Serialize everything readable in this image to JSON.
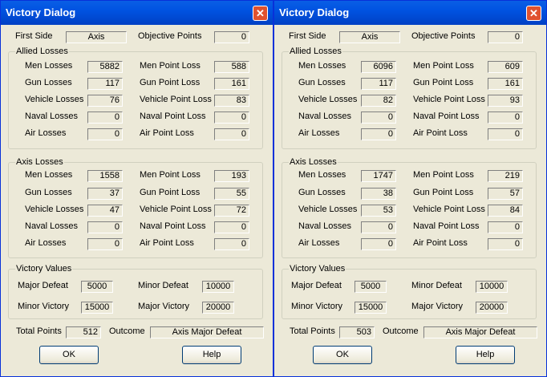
{
  "dialogs": [
    {
      "title": "Victory Dialog",
      "close_glyph": "✕",
      "first_side_label": "First Side",
      "first_side_value": "Axis",
      "objective_points_label": "Objective Points",
      "objective_points_value": "0",
      "allied": {
        "title": "Allied Losses",
        "men_losses_label": "Men Losses",
        "men_losses": "5882",
        "men_point_loss_label": "Men Point Loss",
        "men_point_loss": "588",
        "gun_losses_label": "Gun Losses",
        "gun_losses": "117",
        "gun_point_loss_label": "Gun Point Loss",
        "gun_point_loss": "161",
        "vehicle_losses_label": "Vehicle Losses",
        "vehicle_losses": "76",
        "vehicle_point_loss_label": "Vehicle Point Loss",
        "vehicle_point_loss": "83",
        "naval_losses_label": "Naval Losses",
        "naval_losses": "0",
        "naval_point_loss_label": "Naval Point Loss",
        "naval_point_loss": "0",
        "air_losses_label": "Air Losses",
        "air_losses": "0",
        "air_point_loss_label": "Air Point Loss",
        "air_point_loss": "0"
      },
      "axis": {
        "title": "Axis Losses",
        "men_losses_label": "Men Losses",
        "men_losses": "1558",
        "men_point_loss_label": "Men Point Loss",
        "men_point_loss": "193",
        "gun_losses_label": "Gun Losses",
        "gun_losses": "37",
        "gun_point_loss_label": "Gun Point Loss",
        "gun_point_loss": "55",
        "vehicle_losses_label": "Vehicle Losses",
        "vehicle_losses": "47",
        "vehicle_point_loss_label": "Vehicle Point Loss",
        "vehicle_point_loss": "72",
        "naval_losses_label": "Naval Losses",
        "naval_losses": "0",
        "naval_point_loss_label": "Naval Point Loss",
        "naval_point_loss": "0",
        "air_losses_label": "Air Losses",
        "air_losses": "0",
        "air_point_loss_label": "Air Point Loss",
        "air_point_loss": "0"
      },
      "victory": {
        "title": "Victory Values",
        "major_defeat_label": "Major Defeat",
        "major_defeat": "5000",
        "minor_defeat_label": "Minor Defeat",
        "minor_defeat": "10000",
        "minor_victory_label": "Minor Victory",
        "minor_victory": "15000",
        "major_victory_label": "Major Victory",
        "major_victory": "20000"
      },
      "total_points_label": "Total Points",
      "total_points": "512",
      "outcome_label": "Outcome",
      "outcome": "Axis Major Defeat",
      "ok_label": "OK",
      "help_label": "Help"
    },
    {
      "title": "Victory Dialog",
      "close_glyph": "✕",
      "first_side_label": "First Side",
      "first_side_value": "Axis",
      "objective_points_label": "Objective Points",
      "objective_points_value": "0",
      "allied": {
        "title": "Allied Losses",
        "men_losses_label": "Men Losses",
        "men_losses": "6096",
        "men_point_loss_label": "Men Point Loss",
        "men_point_loss": "609",
        "gun_losses_label": "Gun Losses",
        "gun_losses": "117",
        "gun_point_loss_label": "Gun Point Loss",
        "gun_point_loss": "161",
        "vehicle_losses_label": "Vehicle Losses",
        "vehicle_losses": "82",
        "vehicle_point_loss_label": "Vehicle Point Loss",
        "vehicle_point_loss": "93",
        "naval_losses_label": "Naval Losses",
        "naval_losses": "0",
        "naval_point_loss_label": "Naval Point Loss",
        "naval_point_loss": "0",
        "air_losses_label": "Air Losses",
        "air_losses": "0",
        "air_point_loss_label": "Air Point Loss",
        "air_point_loss": "0"
      },
      "axis": {
        "title": "Axis Losses",
        "men_losses_label": "Men Losses",
        "men_losses": "1747",
        "men_point_loss_label": "Men Point Loss",
        "men_point_loss": "219",
        "gun_losses_label": "Gun Losses",
        "gun_losses": "38",
        "gun_point_loss_label": "Gun Point Loss",
        "gun_point_loss": "57",
        "vehicle_losses_label": "Vehicle Losses",
        "vehicle_losses": "53",
        "vehicle_point_loss_label": "Vehicle Point Loss",
        "vehicle_point_loss": "84",
        "naval_losses_label": "Naval Losses",
        "naval_losses": "0",
        "naval_point_loss_label": "Naval Point Loss",
        "naval_point_loss": "0",
        "air_losses_label": "Air Losses",
        "air_losses": "0",
        "air_point_loss_label": "Air Point Loss",
        "air_point_loss": "0"
      },
      "victory": {
        "title": "Victory Values",
        "major_defeat_label": "Major Defeat",
        "major_defeat": "5000",
        "minor_defeat_label": "Minor Defeat",
        "minor_defeat": "10000",
        "minor_victory_label": "Minor Victory",
        "minor_victory": "15000",
        "major_victory_label": "Major Victory",
        "major_victory": "20000"
      },
      "total_points_label": "Total Points",
      "total_points": "503",
      "outcome_label": "Outcome",
      "outcome": "Axis Major Defeat",
      "ok_label": "OK",
      "help_label": "Help"
    }
  ]
}
